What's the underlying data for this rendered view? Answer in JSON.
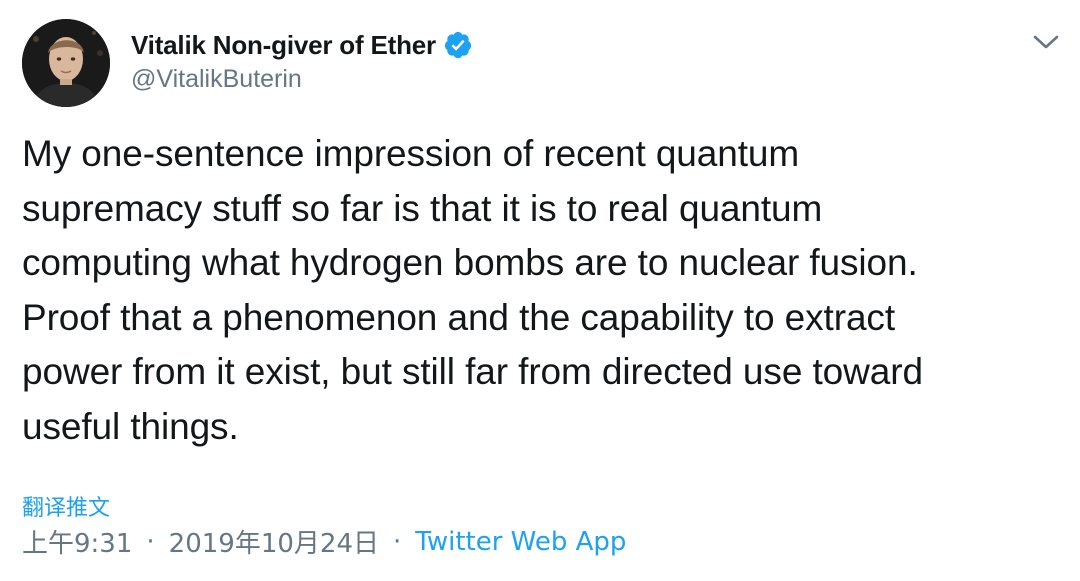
{
  "author": {
    "display_name": "Vitalik Non-giver of Ether",
    "handle": "@VitalikButerin",
    "verified": true
  },
  "tweet": {
    "text": "My one-sentence impression of recent quantum\nsupremacy stuff so far is that it is to real quantum\ncomputing what hydrogen bombs are to nuclear fusion.\nProof that a phenomenon and the capability to extract\npower from it exist, but still far from directed use toward\nuseful things.",
    "translate_label": "翻译推文",
    "time": "上午9:31",
    "date": "2019年10月24日",
    "separator": "·",
    "source": "Twitter Web App"
  },
  "icons": {
    "verified": "verified-badge-icon",
    "menu": "chevron-down-icon"
  },
  "colors": {
    "accent": "#1da1f2",
    "text": "#14171a",
    "secondary": "#657786"
  }
}
